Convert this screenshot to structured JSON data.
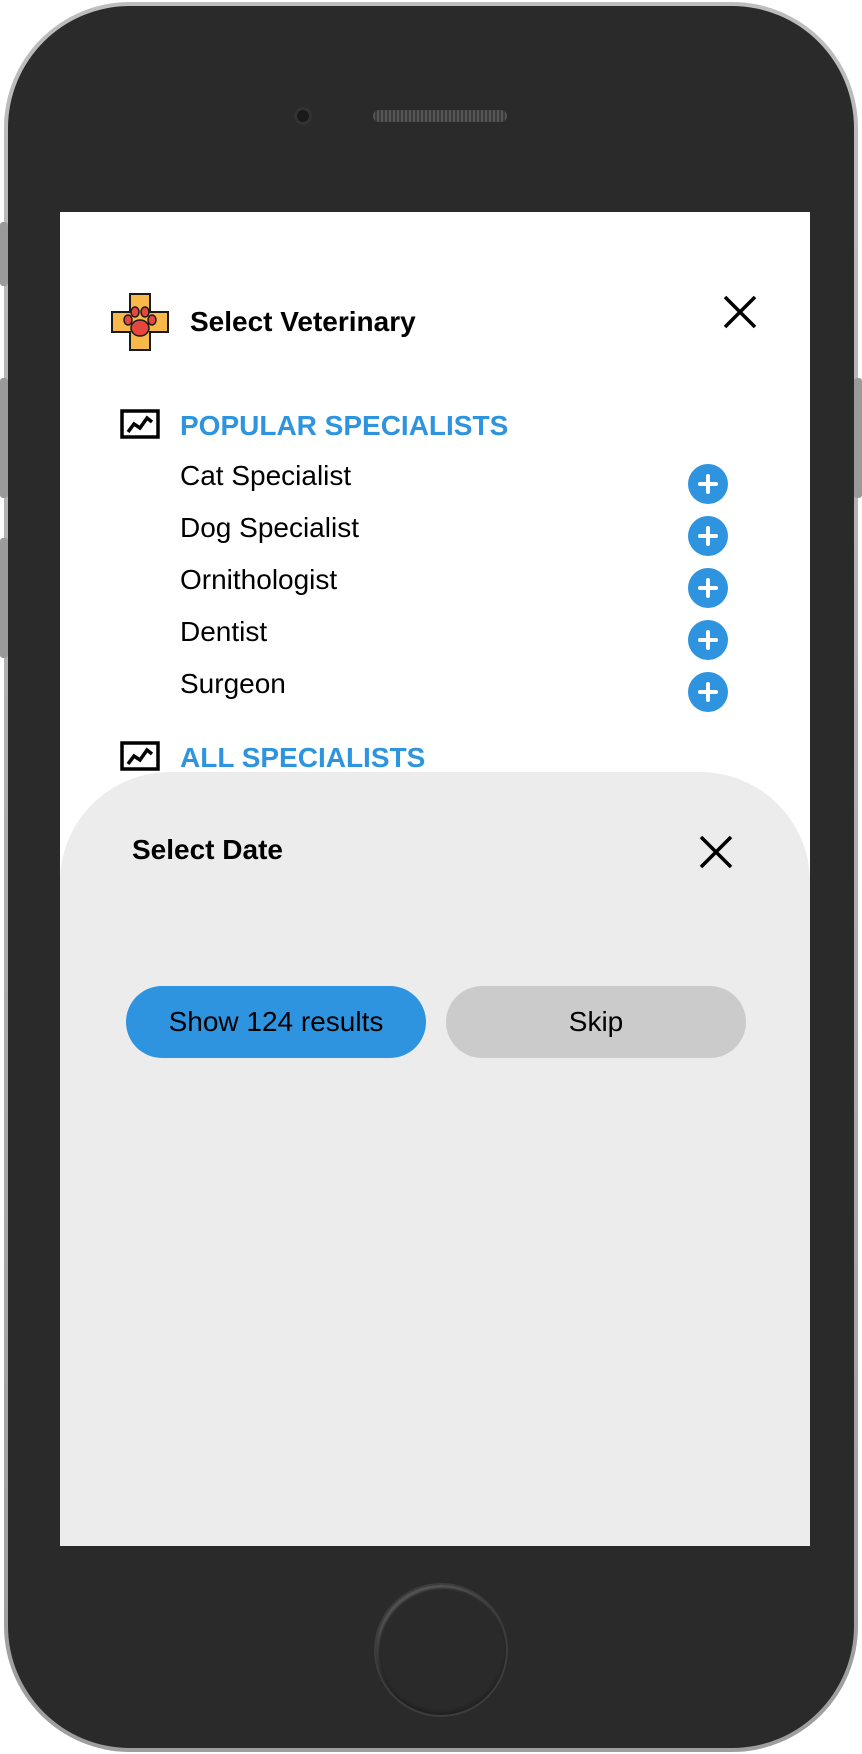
{
  "header": {
    "title": "Select Veterinary",
    "logo_icon": "paw-cross-icon",
    "close_icon": "close-icon"
  },
  "popular": {
    "title": "POPULAR SPECIALISTS",
    "icon": "chart-icon",
    "items": [
      {
        "label": "Cat Specialist",
        "action_icon": "add-icon"
      },
      {
        "label": "Dog Specialist",
        "action_icon": "add-icon"
      },
      {
        "label": "Ornithologist",
        "action_icon": "add-icon"
      },
      {
        "label": "Dentist",
        "action_icon": "add-icon"
      },
      {
        "label": "Surgeon",
        "action_icon": "add-icon"
      }
    ]
  },
  "all": {
    "title": "ALL SPECIALISTS",
    "icon": "chart-icon"
  },
  "date_sheet": {
    "title": "Select Date",
    "close_icon": "close-icon",
    "primary_label": "Show 124 results",
    "secondary_label": "Skip"
  },
  "colors": {
    "accent": "#2e94df",
    "sheet_bg": "#ececec",
    "secondary_button": "#cbcbcb",
    "logo_fill": "#f9b84a",
    "paw": "#e5473e"
  }
}
